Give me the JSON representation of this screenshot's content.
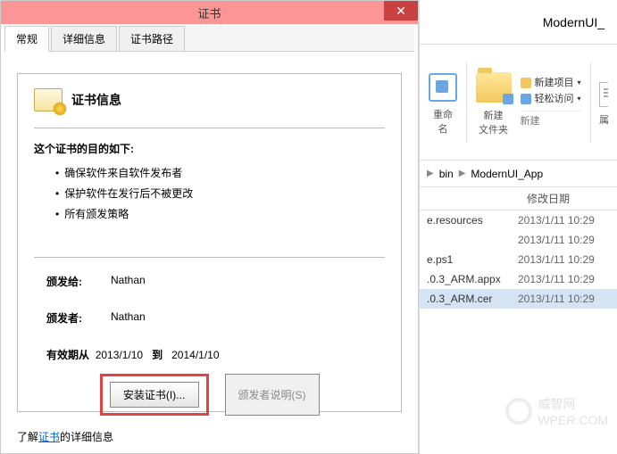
{
  "dialog": {
    "title": "证书",
    "tabs": [
      "常规",
      "详细信息",
      "证书路径"
    ],
    "cert_info_label": "证书信息",
    "purpose_label": "这个证书的目的如下:",
    "purposes": [
      "确保软件来自软件发布者",
      "保护软件在发行后不被更改",
      "所有颁发策略"
    ],
    "issued_to_label": "颁发给:",
    "issued_to": "Nathan",
    "issued_by_label": "颁发者:",
    "issued_by": "Nathan",
    "validity_prefix": "有效期从",
    "valid_from": "2013/1/10",
    "validity_to": "到",
    "valid_to": "2014/1/10",
    "install_btn": "安装证书(I)...",
    "issuer_stmt_btn": "颁发者说明(S)",
    "learn_prefix": "了解",
    "learn_link": "证书",
    "learn_suffix": "的详细信息"
  },
  "explorer": {
    "title_fragment": "ModernUI_",
    "rename_label": "重命名",
    "newfolder_label": "新建\n文件夹",
    "new_item": "新建项目",
    "easy_access": "轻松访问",
    "group_new": "新建",
    "prop_char": "属",
    "bc_bin": "bin",
    "bc_app": "ModernUI_App",
    "col_date": "修改日期",
    "files": [
      {
        "name": "e.resources",
        "date": "2013/1/11 10:29"
      },
      {
        "name": "",
        "date": "2013/1/11 10:29"
      },
      {
        "name": "e.ps1",
        "date": "2013/1/11 10:29"
      },
      {
        "name": ".0.3_ARM.appx",
        "date": "2013/1/11 10:29"
      },
      {
        "name": ".0.3_ARM.cer",
        "date": "2013/1/11 10:29"
      }
    ]
  },
  "watermark": {
    "text1": "威智网",
    "text2": "WPER.COM"
  }
}
